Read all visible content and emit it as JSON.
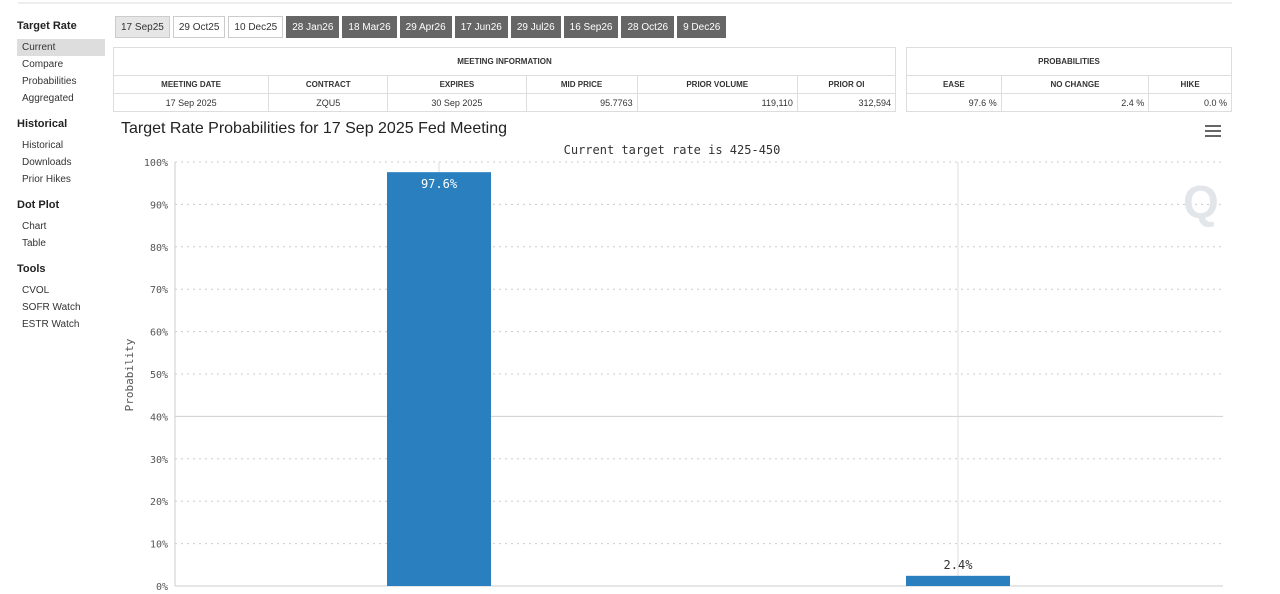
{
  "sidebar": {
    "sections": [
      {
        "title": "Target Rate",
        "items": [
          "Current",
          "Compare",
          "Probabilities",
          "Aggregated"
        ],
        "active": 0
      },
      {
        "title": "Historical",
        "items": [
          "Historical",
          "Downloads",
          "Prior Hikes"
        ],
        "active": -1
      },
      {
        "title": "Dot Plot",
        "items": [
          "Chart",
          "Table"
        ],
        "active": -1
      },
      {
        "title": "Tools",
        "items": [
          "CVOL",
          "SOFR Watch",
          "ESTR Watch"
        ],
        "active": -1
      }
    ]
  },
  "tabs": [
    {
      "label": "17 Sep25",
      "style": "selected"
    },
    {
      "label": "29 Oct25",
      "style": "light"
    },
    {
      "label": "10 Dec25",
      "style": "light"
    },
    {
      "label": "28 Jan26",
      "style": "dark"
    },
    {
      "label": "18 Mar26",
      "style": "dark"
    },
    {
      "label": "29 Apr26",
      "style": "dark"
    },
    {
      "label": "17 Jun26",
      "style": "dark"
    },
    {
      "label": "29 Jul26",
      "style": "dark"
    },
    {
      "label": "16 Sep26",
      "style": "dark"
    },
    {
      "label": "28 Oct26",
      "style": "dark"
    },
    {
      "label": "9 Dec26",
      "style": "dark"
    }
  ],
  "meeting_info": {
    "caption": "MEETING INFORMATION",
    "headers": [
      "MEETING DATE",
      "CONTRACT",
      "EXPIRES",
      "MID PRICE",
      "PRIOR VOLUME",
      "PRIOR OI"
    ],
    "values": [
      "17 Sep 2025",
      "ZQU5",
      "30 Sep 2025",
      "95.7763",
      "119,110",
      "312,594"
    ]
  },
  "probabilities": {
    "caption": "PROBABILITIES",
    "headers": [
      "EASE",
      "NO CHANGE",
      "HIKE"
    ],
    "values": [
      "97.6 %",
      "2.4 %",
      "0.0 %"
    ]
  },
  "chart": {
    "title": "Target Rate Probabilities for 17 Sep 2025 Fed Meeting",
    "subtitle": "Current target rate is 425-450",
    "bar_color": "#2a7fbf"
  },
  "chart_data": {
    "type": "bar",
    "title": "Target Rate Probabilities for 17 Sep 2025 Fed Meeting",
    "subtitle": "Current target rate is 425-450",
    "ylabel": "Probability",
    "ylim": [
      0,
      100
    ],
    "yticks": [
      "0%",
      "10%",
      "20%",
      "30%",
      "40%",
      "50%",
      "60%",
      "70%",
      "80%",
      "90%",
      "100%"
    ],
    "values": [
      97.6,
      2.4
    ],
    "labels": [
      "97.6%",
      "2.4%"
    ],
    "grid": true,
    "legend": "none"
  }
}
